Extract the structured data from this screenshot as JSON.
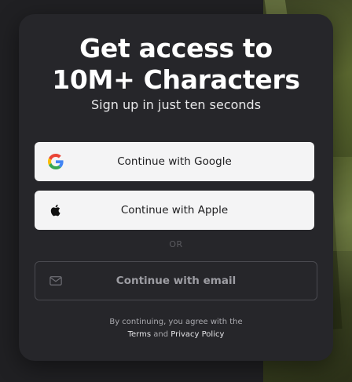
{
  "modal": {
    "title_line1": "Get access to",
    "title_line2": "10M+ Characters",
    "subtitle": "Sign up in just ten seconds",
    "google_button": {
      "label": "Continue with Google",
      "icon": "google-icon"
    },
    "apple_button": {
      "label": "Continue with Apple",
      "icon": "apple-icon"
    },
    "divider": "OR",
    "email_button": {
      "label": "Continue with email",
      "icon": "mail-icon"
    },
    "legal": {
      "line1": "By continuing, you agree with the",
      "terms": "Terms",
      "and": "and",
      "privacy": "Privacy Policy"
    }
  },
  "colors": {
    "modal_bg": "#26262a",
    "button_bg": "#f4f4f5",
    "page_bg": "#202023"
  }
}
